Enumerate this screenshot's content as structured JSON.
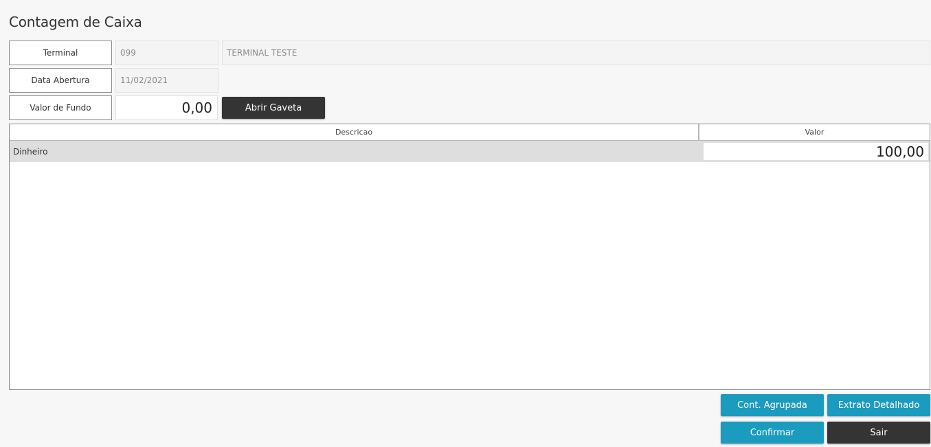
{
  "title": "Contagem de Caixa",
  "terminal": {
    "label": "Terminal",
    "code": "099",
    "name": "TERMINAL TESTE"
  },
  "data_abertura": {
    "label": "Data Abertura",
    "value": "11/02/2021"
  },
  "valor_fundo": {
    "label": "Valor de Fundo",
    "value": "0,00"
  },
  "buttons": {
    "abrir_gaveta": "Abrir Gaveta",
    "cont_agrupada": "Cont. Agrupada",
    "extrato_detalhado": "Extrato Detalhado",
    "confirmar": "Confirmar",
    "sair": "Sair"
  },
  "grid": {
    "columns": [
      "Descricao",
      "Valor"
    ],
    "rows": [
      {
        "descricao": "Dinheiro",
        "valor": "100,00"
      }
    ]
  },
  "colors": {
    "accent": "#1b9bbd",
    "dark": "#343434"
  }
}
